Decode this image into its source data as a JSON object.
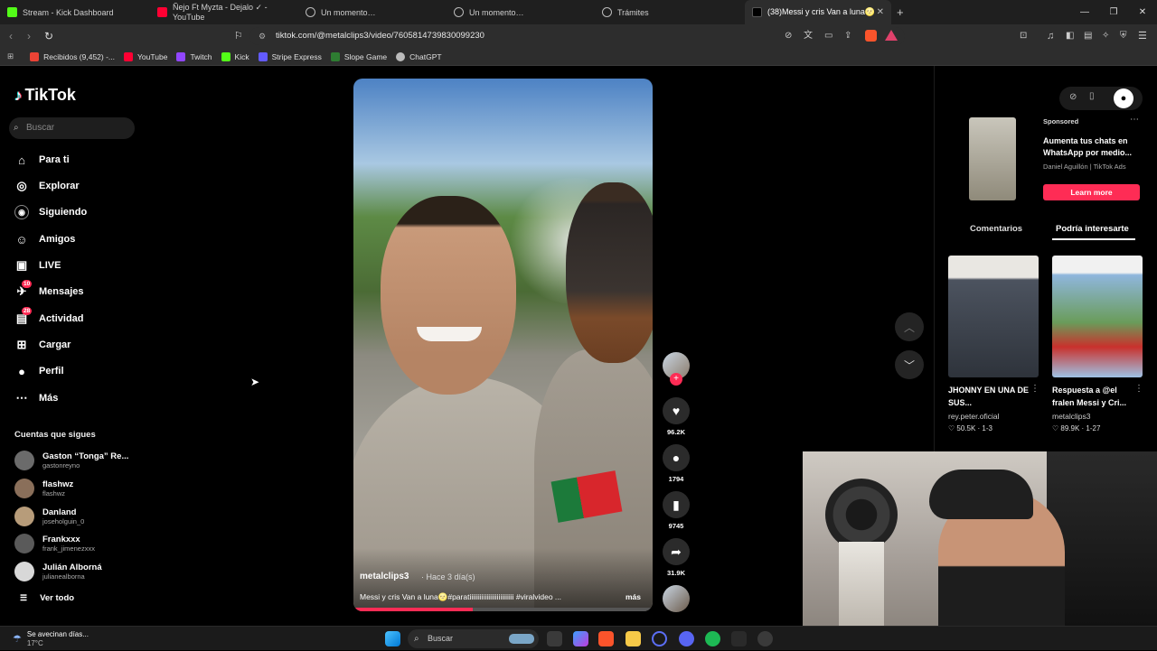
{
  "browser": {
    "tabs": [
      {
        "label": "Stream - Kick Dashboard",
        "color": "#53fc18"
      },
      {
        "label": "Ñejo Ft Myzta - Dejalo ✓ - YouTube",
        "color": "#ff0033"
      },
      {
        "label": "Un momento…",
        "color": "#9aa0a6"
      },
      {
        "label": "Un momento…",
        "color": "#9aa0a6"
      },
      {
        "label": "Trámites",
        "color": "#9aa0a6"
      },
      {
        "label": "(38)Messi y cris Van a luna🌝",
        "color": "#ffffff"
      }
    ],
    "url": "tiktok.com/@metalclips3/video/7605814739830099230",
    "bookmarks": [
      {
        "label": "Recibidos (9,452) -...",
        "color": "#ea4335"
      },
      {
        "label": "YouTube",
        "color": "#ff0033"
      },
      {
        "label": "Twitch",
        "color": "#9146ff"
      },
      {
        "label": "Kick",
        "color": "#53fc18"
      },
      {
        "label": "Stripe Express",
        "color": "#635bff"
      },
      {
        "label": "Slope Game",
        "color": "#2e7d32"
      },
      {
        "label": "ChatGPT",
        "color": "#bbbbbb"
      }
    ]
  },
  "tiktok": {
    "logo": "TikTok",
    "search_placeholder": "Buscar",
    "nav": [
      {
        "label": "Para ti",
        "icon": "home-icon",
        "glyph": "⌂"
      },
      {
        "label": "Explorar",
        "icon": "compass-icon",
        "glyph": "◎"
      },
      {
        "label": "Siguiendo",
        "icon": "following-icon",
        "glyph": "◉"
      },
      {
        "label": "Amigos",
        "icon": "friends-icon",
        "glyph": "☺"
      },
      {
        "label": "LIVE",
        "icon": "live-icon",
        "glyph": "▣"
      },
      {
        "label": "Mensajes",
        "icon": "messages-icon",
        "glyph": "✈",
        "badge": "10"
      },
      {
        "label": "Actividad",
        "icon": "activity-icon",
        "glyph": "▤",
        "badge": "28"
      },
      {
        "label": "Cargar",
        "icon": "upload-icon",
        "glyph": "⊞"
      },
      {
        "label": "Perfil",
        "icon": "profile-icon",
        "glyph": "●"
      },
      {
        "label": "Más",
        "icon": "more-icon",
        "glyph": "⋯"
      }
    ],
    "following_title": "Cuentas que sigues",
    "following": [
      {
        "name": "Gaston “Tonga” Re...",
        "handle": "gastonreyno",
        "color": "#6b6b6b"
      },
      {
        "name": "flashwz",
        "handle": "flashwz",
        "color": "#8a6f5a"
      },
      {
        "name": "Danland",
        "handle": "joseholguin_0",
        "color": "#b79c7a"
      },
      {
        "name": "Frankxxx",
        "handle": "frank_jimenezxxx",
        "color": "#5a5a5a"
      },
      {
        "name": "Julián Alborná",
        "handle": "julianealborna",
        "color": "#d8d8d8"
      }
    ],
    "see_all": "Ver todo",
    "video": {
      "author": "metalclips3",
      "when": "· Hace 3 día(s)",
      "description": "Messi y cris Van a luna🌝#paratiiiiiiiiiiiiiiiiiiiiiiiiii #viralvideo ...",
      "more": "más",
      "likes": "96.2K",
      "comments": "1794",
      "saves": "9745",
      "shares": "31.9K"
    },
    "ad": {
      "sponsored": "Sponsored",
      "title": "Aumenta tus chats en WhatsApp por medio...",
      "by": "Daniel Aguillón | TikTok Ads",
      "cta": "Learn more"
    },
    "tabs": {
      "comments": "Comentarios",
      "suggested": "Podría interesarte"
    },
    "suggested": [
      {
        "title": "JHONNY EN UNA DE SUS...",
        "user": "rey.peter.oficial",
        "meta": "♡ 50.5K · 1-3",
        "color": "#5a6170"
      },
      {
        "title": "Respuesta a @el fralen Messi y Cri...",
        "user": "metalclips3",
        "meta": "♡ 89.9K · 1-27",
        "color": "#6fa1d8"
      }
    ]
  },
  "taskbar": {
    "weather_text": "Se avecinan días...",
    "temperature": "17°C",
    "search_placeholder": "Buscar"
  }
}
